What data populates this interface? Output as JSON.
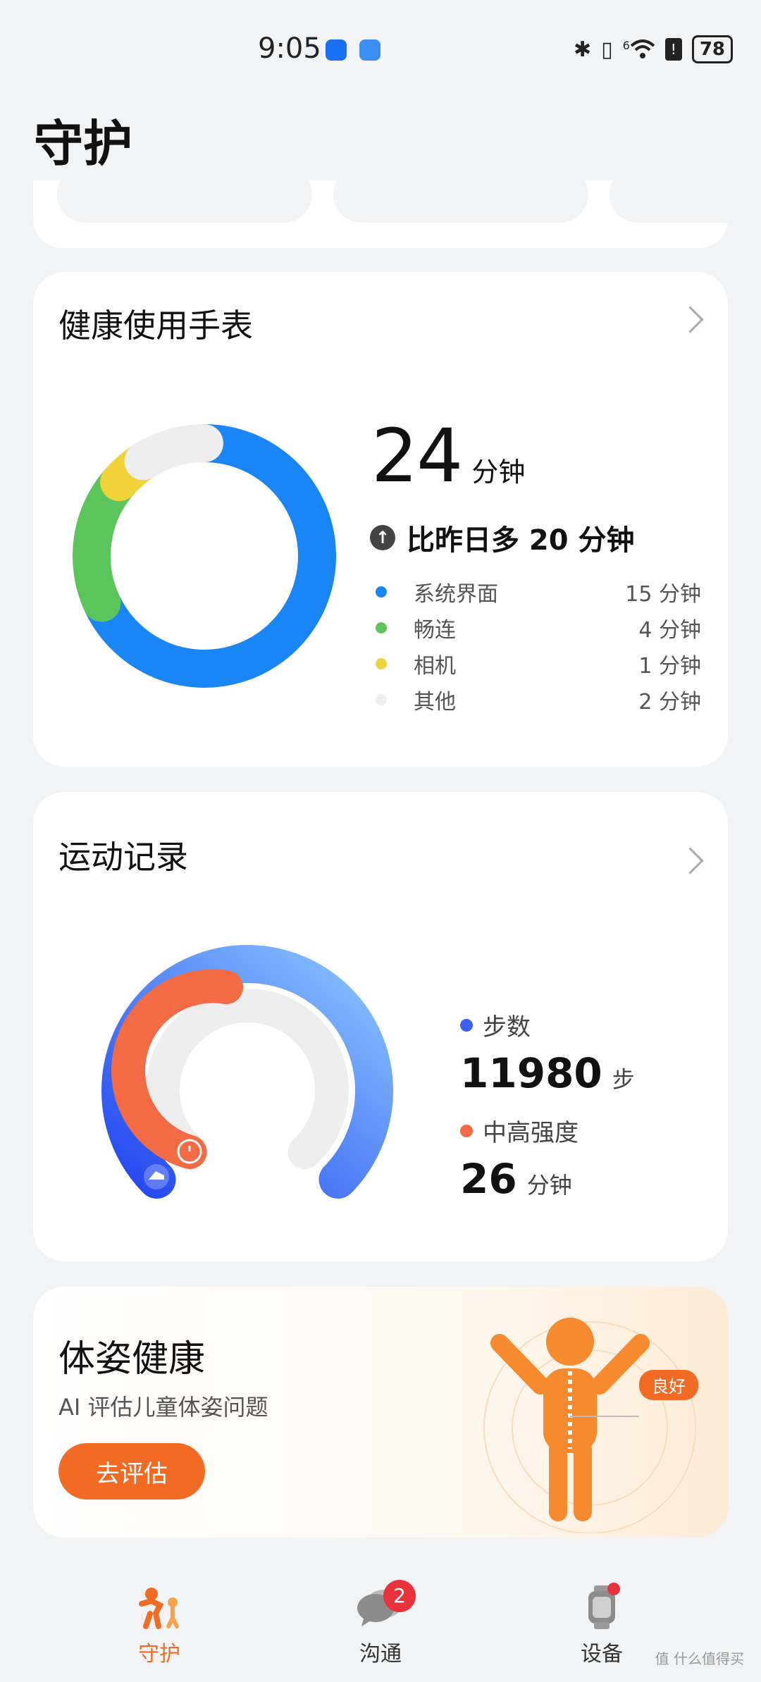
{
  "status_bar": {
    "time": "9:05",
    "battery": "78",
    "network": "6"
  },
  "page": {
    "title": "守护"
  },
  "screen_time": {
    "title": "健康使用手表",
    "total_value": "24",
    "total_unit": "分钟",
    "compare_text": "比昨日多 20 分钟",
    "segments": [
      {
        "name": "系统界面",
        "minutes": 15,
        "value_text": "15 分钟",
        "color": "#1a86f5"
      },
      {
        "name": "畅连",
        "minutes": 4,
        "value_text": "4 分钟",
        "color": "#5bc55b"
      },
      {
        "name": "相机",
        "minutes": 1,
        "value_text": "1 分钟",
        "color": "#f0d33a"
      },
      {
        "name": "其他",
        "minutes": 2,
        "value_text": "2 分钟",
        "color": "#eeeeee"
      }
    ]
  },
  "exercise": {
    "title": "运动记录",
    "steps_label": "步数",
    "steps_value": "11980",
    "steps_unit": "步",
    "steps_color": "#3b5ff0",
    "intensity_label": "中高强度",
    "intensity_value": "26",
    "intensity_unit": "分钟",
    "intensity_color": "#f26b45"
  },
  "posture": {
    "title": "体姿健康",
    "subtitle": "AI 评估儿童体姿问题",
    "button_label": "去评估",
    "status_tag": "良好"
  },
  "tabbar": {
    "tabs": [
      {
        "label": "守护",
        "active": true
      },
      {
        "label": "沟通",
        "badge": "2"
      },
      {
        "label": "设备"
      }
    ]
  },
  "watermark": "值 什么值得买"
}
